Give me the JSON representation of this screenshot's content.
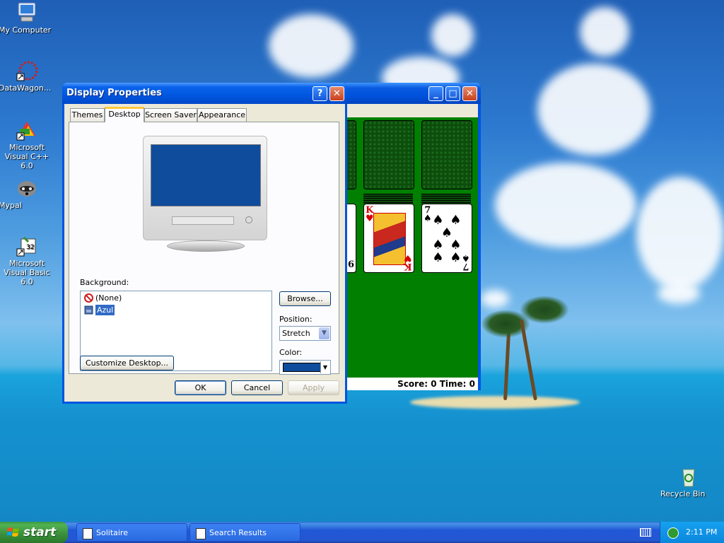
{
  "desktop": {
    "icons": [
      {
        "label": "My Computer",
        "icon": "my-computer-icon"
      },
      {
        "label": "DataWagon...",
        "icon": "datawagon-icon"
      },
      {
        "label": "Microsoft Visual C++ 6.0",
        "icon": "visual-cpp-icon"
      },
      {
        "label": "Mypal",
        "icon": "mypal-raccoon-icon"
      },
      {
        "label": "Microsoft Visual Basic 6.0",
        "icon": "visual-basic-icon"
      },
      {
        "label": "Recycle Bin",
        "icon": "recycle-bin-icon"
      }
    ]
  },
  "solitaire": {
    "status": "Score: 0 Time: 0",
    "cards": [
      {
        "rank": "K",
        "suit": "♥",
        "color": "#d40000"
      },
      {
        "rank": "7",
        "suit": "♠",
        "color": "#000000"
      }
    ],
    "partial_card_rank": "6"
  },
  "dialog": {
    "title": "Display Properties",
    "help_button": "?",
    "close_button": "✕",
    "tabs": [
      "Themes",
      "Desktop",
      "Screen Saver",
      "Appearance"
    ],
    "active_tab": "Desktop",
    "background_label": "Background:",
    "background_items": [
      {
        "label": "(None)",
        "icon": "none-icon",
        "selected": false
      },
      {
        "label": "Azul",
        "icon": "bitmap-icon",
        "selected": true
      }
    ],
    "browse_button": "Browse...",
    "position_label": "Position:",
    "position_value": "Stretch",
    "color_label": "Color:",
    "color_value": "#0f4c9c",
    "customize_button": "Customize Desktop...",
    "ok_button": "OK",
    "cancel_button": "Cancel",
    "apply_button": "Apply"
  },
  "taskbar": {
    "start_label": "start",
    "tasks": [
      {
        "label": "Solitaire",
        "icon": "solitaire-icon"
      },
      {
        "label": "Search Results",
        "icon": "search-results-icon"
      }
    ],
    "clock": "2:11 PM"
  },
  "colors": {
    "xp_blue": "#0054e3",
    "dialog_face": "#ece9d8",
    "felt_green": "#007f00",
    "selection": "#316ac5"
  }
}
